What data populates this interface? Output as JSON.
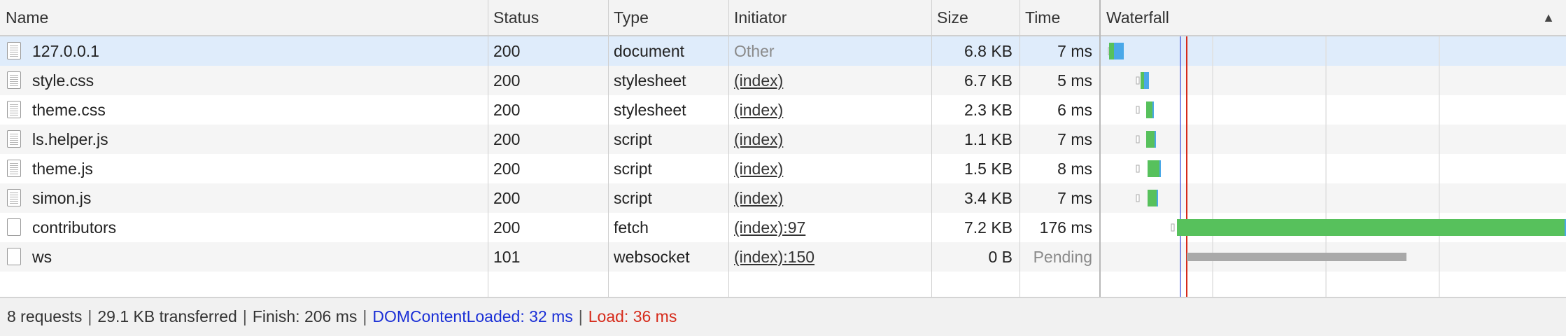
{
  "columns": {
    "name": "Name",
    "status": "Status",
    "type": "Type",
    "initiator": "Initiator",
    "size": "Size",
    "time": "Time",
    "waterfall": "Waterfall",
    "sort_icon": "sort-ascending-icon"
  },
  "requests": [
    {
      "name": "127.0.0.1",
      "status": "200",
      "type": "document",
      "initiator": "Other",
      "initiator_is_link": false,
      "size": "6.8 KB",
      "time": "7 ms",
      "time_pending": false,
      "icon": "document-file-icon",
      "selected": true
    },
    {
      "name": "style.css",
      "status": "200",
      "type": "stylesheet",
      "initiator": "(index)",
      "initiator_is_link": true,
      "size": "6.7 KB",
      "time": "5 ms",
      "time_pending": false,
      "icon": "document-file-icon",
      "selected": false
    },
    {
      "name": "theme.css",
      "status": "200",
      "type": "stylesheet",
      "initiator": "(index)",
      "initiator_is_link": true,
      "size": "2.3 KB",
      "time": "6 ms",
      "time_pending": false,
      "icon": "document-file-icon",
      "selected": false
    },
    {
      "name": "ls.helper.js",
      "status": "200",
      "type": "script",
      "initiator": "(index)",
      "initiator_is_link": true,
      "size": "1.1 KB",
      "time": "7 ms",
      "time_pending": false,
      "icon": "document-file-icon",
      "selected": false
    },
    {
      "name": "theme.js",
      "status": "200",
      "type": "script",
      "initiator": "(index)",
      "initiator_is_link": true,
      "size": "1.5 KB",
      "time": "8 ms",
      "time_pending": false,
      "icon": "document-file-icon",
      "selected": false
    },
    {
      "name": "simon.js",
      "status": "200",
      "type": "script",
      "initiator": "(index)",
      "initiator_is_link": true,
      "size": "3.4 KB",
      "time": "7 ms",
      "time_pending": false,
      "icon": "document-file-icon",
      "selected": false
    },
    {
      "name": "contributors",
      "status": "200",
      "type": "fetch",
      "initiator": "(index):97",
      "initiator_is_link": true,
      "size": "7.2 KB",
      "time": "176 ms",
      "time_pending": false,
      "icon": "blank-file-icon",
      "selected": false
    },
    {
      "name": "ws",
      "status": "101",
      "type": "websocket",
      "initiator": "(index):150",
      "initiator_is_link": true,
      "size": "0 B",
      "time": "Pending",
      "time_pending": true,
      "icon": "blank-file-icon",
      "selected": false
    }
  ],
  "footer": {
    "requests": "8 requests",
    "transferred": "29.1 KB transferred",
    "finish": "Finish: 206 ms",
    "dom_content_loaded": "DOMContentLoaded: 32 ms",
    "load": "Load: 36 ms",
    "separator": "|"
  },
  "colors": {
    "dcl_line": "#1a2fd6",
    "load_line": "#d62a1a",
    "waiting_green": "#57c15c",
    "download_blue": "#4aa8e8",
    "pending_gray": "#a9a9a9",
    "selected_row": "#dfecfb"
  }
}
